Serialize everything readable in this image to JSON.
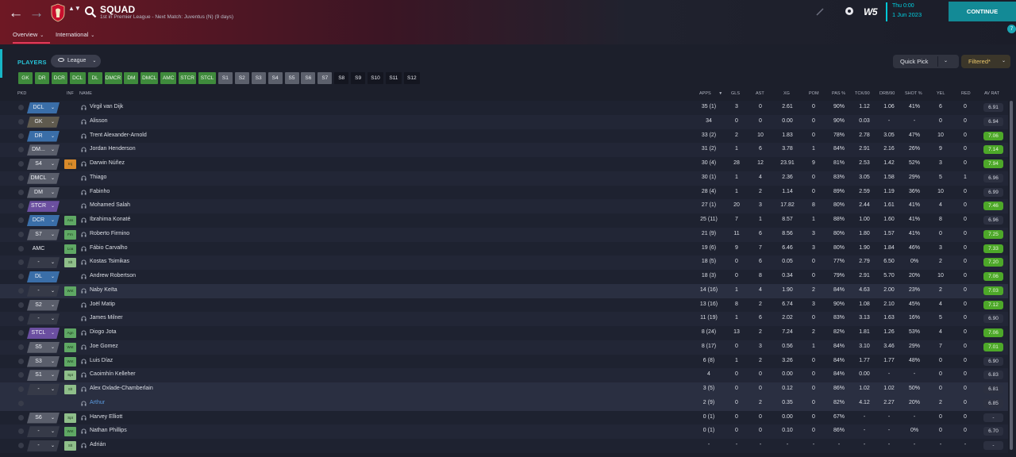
{
  "header": {
    "title": "SQUAD",
    "subtitle": "1st in Premier League - Next Match: Juventus (N) (9 days)",
    "back_glyph": "←",
    "forward_glyph": "→",
    "club_updown": "▲▼",
    "brand": "W5",
    "time": "Thu 0:00",
    "date": "1 Jun 2023",
    "continue": "CONTINUE",
    "notification_count": "7",
    "accent": "#17b6c6",
    "crest_color": "#c8102e"
  },
  "tabs": [
    {
      "label": "Overview",
      "chevron": "⌄"
    },
    {
      "label": "International",
      "chevron": "⌄"
    }
  ],
  "toolbar": {
    "players_label": "PLAYERS",
    "league_label": "League",
    "quick_pick": "Quick Pick",
    "filtered": "Filtered*",
    "chevron": "⌄"
  },
  "position_filters": [
    {
      "label": "GK",
      "style": "green"
    },
    {
      "label": "DR",
      "style": "green"
    },
    {
      "label": "DCR",
      "style": "green"
    },
    {
      "label": "DCL",
      "style": "green"
    },
    {
      "label": "DL",
      "style": "green"
    },
    {
      "label": "DMCR",
      "style": "green"
    },
    {
      "label": "DM",
      "style": "green"
    },
    {
      "label": "DMCL",
      "style": "green"
    },
    {
      "label": "AMC",
      "style": "green"
    },
    {
      "label": "STCR",
      "style": "green"
    },
    {
      "label": "STCL",
      "style": "green"
    },
    {
      "label": "S1",
      "style": "grey"
    },
    {
      "label": "S2",
      "style": "grey"
    },
    {
      "label": "S3",
      "style": "grey"
    },
    {
      "label": "S4",
      "style": "grey"
    },
    {
      "label": "S5",
      "style": "grey"
    },
    {
      "label": "S6",
      "style": "grey"
    },
    {
      "label": "S7",
      "style": "grey"
    },
    {
      "label": "S8",
      "style": "dark"
    },
    {
      "label": "S9",
      "style": "dark"
    },
    {
      "label": "S10",
      "style": "dark"
    },
    {
      "label": "S11",
      "style": "dark"
    },
    {
      "label": "S12",
      "style": "dark"
    }
  ],
  "columns": {
    "pkd": "PKD",
    "inf": "INF",
    "name": "NAME",
    "apps": "APPS",
    "sort": "▼",
    "gls": "GLS",
    "ast": "AST",
    "xg": "XG",
    "pom": "POM",
    "pas": "PAS %",
    "tck": "TCK/90",
    "drb": "DRB/90",
    "shot": "SHOT %",
    "yel": "YEL",
    "red": "RED",
    "avrat": "AV RAT"
  },
  "players": [
    {
      "pos": "DCL",
      "pos_color": "#3a6ea8",
      "inf": "",
      "inf_color": "",
      "name": "Virgil van Dijk",
      "apps": "35 (1)",
      "gls": "3",
      "ast": "0",
      "xg": "2.61",
      "pom": "0",
      "pas": "90%",
      "tck": "1.12",
      "drb": "1.06",
      "shot": "41%",
      "yel": "6",
      "red": "0",
      "rat": "6.91",
      "rat_good": false,
      "hl": false
    },
    {
      "pos": "GK",
      "pos_color": "#5f5a4e",
      "inf": "",
      "inf_color": "",
      "name": "Alisson",
      "apps": "34",
      "gls": "0",
      "ast": "0",
      "xg": "0.00",
      "pom": "0",
      "pas": "90%",
      "tck": "0.03",
      "drb": "-",
      "shot": "-",
      "yel": "0",
      "red": "0",
      "rat": "6.94",
      "rat_good": false,
      "hl": false
    },
    {
      "pos": "DR",
      "pos_color": "#3a6ea8",
      "inf": "",
      "inf_color": "",
      "name": "Trent Alexander-Arnold",
      "apps": "33 (2)",
      "gls": "2",
      "ast": "10",
      "xg": "1.83",
      "pom": "0",
      "pas": "78%",
      "tck": "2.78",
      "drb": "3.05",
      "shot": "47%",
      "yel": "10",
      "red": "0",
      "rat": "7.06",
      "rat_good": true,
      "hl": false
    },
    {
      "pos": "DM...",
      "pos_color": "#5a5e6b",
      "inf": "",
      "inf_color": "",
      "name": "Jordan Henderson",
      "apps": "31 (2)",
      "gls": "1",
      "ast": "6",
      "xg": "3.78",
      "pom": "1",
      "pas": "84%",
      "tck": "2.91",
      "drb": "2.16",
      "shot": "26%",
      "yel": "9",
      "red": "0",
      "rat": "7.14",
      "rat_good": true,
      "hl": false
    },
    {
      "pos": "S4",
      "pos_color": "#5a5e6b",
      "inf": "Inj",
      "inf_color": "#d98a2a",
      "name": "Darwin Núñez",
      "apps": "30 (4)",
      "gls": "28",
      "ast": "12",
      "xg": "23.91",
      "pom": "9",
      "pas": "81%",
      "tck": "2.53",
      "drb": "1.42",
      "shot": "52%",
      "yel": "3",
      "red": "0",
      "rat": "7.94",
      "rat_good": true,
      "hl": false
    },
    {
      "pos": "DMCL",
      "pos_color": "#5a5e6b",
      "inf": "",
      "inf_color": "",
      "name": "Thiago",
      "apps": "30 (1)",
      "gls": "1",
      "ast": "4",
      "xg": "2.36",
      "pom": "0",
      "pas": "83%",
      "tck": "3.05",
      "drb": "1.58",
      "shot": "29%",
      "yel": "5",
      "red": "1",
      "rat": "6.96",
      "rat_good": false,
      "hl": false
    },
    {
      "pos": "DM",
      "pos_color": "#5a5e6b",
      "inf": "",
      "inf_color": "",
      "name": "Fabinho",
      "apps": "28 (4)",
      "gls": "1",
      "ast": "2",
      "xg": "1.14",
      "pom": "0",
      "pas": "89%",
      "tck": "2.59",
      "drb": "1.19",
      "shot": "36%",
      "yel": "10",
      "red": "0",
      "rat": "6.99",
      "rat_good": false,
      "hl": false
    },
    {
      "pos": "STCR",
      "pos_color": "#6b4fa0",
      "inf": "",
      "inf_color": "",
      "name": "Mohamed Salah",
      "apps": "27 (1)",
      "gls": "20",
      "ast": "3",
      "xg": "17.82",
      "pom": "8",
      "pas": "80%",
      "tck": "2.44",
      "drb": "1.61",
      "shot": "41%",
      "yel": "4",
      "red": "0",
      "rat": "7.46",
      "rat_good": true,
      "hl": false
    },
    {
      "pos": "DCR",
      "pos_color": "#3a6ea8",
      "inf": "Ass",
      "inf_color": "#5fa864",
      "name": "Ibrahima Konaté",
      "apps": "25 (11)",
      "gls": "7",
      "ast": "1",
      "xg": "8.57",
      "pom": "1",
      "pas": "88%",
      "tck": "1.00",
      "drb": "1.60",
      "shot": "41%",
      "yel": "8",
      "red": "0",
      "rat": "6.96",
      "rat_good": false,
      "hl": false
    },
    {
      "pos": "S7",
      "pos_color": "#5a5e6b",
      "inf": "Frn",
      "inf_color": "#5fa864",
      "name": "Roberto Firmino",
      "apps": "21 (9)",
      "gls": "11",
      "ast": "6",
      "xg": "8.56",
      "pom": "3",
      "pas": "80%",
      "tck": "1.80",
      "drb": "1.57",
      "shot": "41%",
      "yel": "0",
      "red": "0",
      "rat": "7.25",
      "rat_good": true,
      "hl": false
    },
    {
      "pos": "AMC",
      "pos_color": "",
      "inf": "Loa",
      "inf_color": "#5fa864",
      "name": "Fábio Carvalho",
      "apps": "19 (6)",
      "gls": "9",
      "ast": "7",
      "xg": "6.46",
      "pom": "3",
      "pas": "80%",
      "tck": "1.90",
      "drb": "1.84",
      "shot": "46%",
      "yel": "3",
      "red": "0",
      "rat": "7.33",
      "rat_good": true,
      "hl": false
    },
    {
      "pos": "-",
      "pos_color": "#363a48",
      "inf": "Slt",
      "inf_color": "#8fbf8a",
      "name": "Kostas Tsimikas",
      "apps": "18 (5)",
      "gls": "0",
      "ast": "6",
      "xg": "0.05",
      "pom": "0",
      "pas": "77%",
      "tck": "2.79",
      "drb": "6.50",
      "shot": "0%",
      "yel": "2",
      "red": "0",
      "rat": "7.20",
      "rat_good": true,
      "hl": false
    },
    {
      "pos": "DL",
      "pos_color": "#3a6ea8",
      "inf": "",
      "inf_color": "",
      "name": "Andrew Robertson",
      "apps": "18 (3)",
      "gls": "0",
      "ast": "8",
      "xg": "0.34",
      "pom": "0",
      "pas": "79%",
      "tck": "2.91",
      "drb": "5.70",
      "shot": "20%",
      "yel": "10",
      "red": "0",
      "rat": "7.06",
      "rat_good": true,
      "hl": false
    },
    {
      "pos": "-",
      "pos_color": "#363a48",
      "inf": "Wnt",
      "inf_color": "#5fa864",
      "name": "Naby Keïta",
      "apps": "14 (16)",
      "gls": "1",
      "ast": "4",
      "xg": "1.90",
      "pom": "2",
      "pas": "84%",
      "tck": "4.63",
      "drb": "2.00",
      "shot": "23%",
      "yel": "2",
      "red": "0",
      "rat": "7.03",
      "rat_good": true,
      "hl": true
    },
    {
      "pos": "S2",
      "pos_color": "#5a5e6b",
      "inf": "",
      "inf_color": "",
      "name": "Joël Matip",
      "apps": "13 (16)",
      "gls": "8",
      "ast": "2",
      "xg": "6.74",
      "pom": "3",
      "pas": "90%",
      "tck": "1.08",
      "drb": "2.10",
      "shot": "45%",
      "yel": "4",
      "red": "0",
      "rat": "7.12",
      "rat_good": true,
      "hl": false
    },
    {
      "pos": "-",
      "pos_color": "#363a48",
      "inf": "",
      "inf_color": "",
      "name": "James Milner",
      "apps": "11 (19)",
      "gls": "1",
      "ast": "6",
      "xg": "2.02",
      "pom": "0",
      "pas": "83%",
      "tck": "3.13",
      "drb": "1.63",
      "shot": "16%",
      "yel": "5",
      "red": "0",
      "rat": "6.90",
      "rat_good": false,
      "hl": false
    },
    {
      "pos": "STCL",
      "pos_color": "#6b4fa0",
      "inf": "Agn",
      "inf_color": "#5fa864",
      "name": "Diogo Jota",
      "apps": "8 (24)",
      "gls": "13",
      "ast": "2",
      "xg": "7.24",
      "pom": "2",
      "pas": "82%",
      "tck": "1.81",
      "drb": "1.26",
      "shot": "53%",
      "yel": "4",
      "red": "0",
      "rat": "7.06",
      "rat_good": true,
      "hl": false
    },
    {
      "pos": "S5",
      "pos_color": "#5a5e6b",
      "inf": "Wnt",
      "inf_color": "#5fa864",
      "name": "Joe Gomez",
      "apps": "8 (17)",
      "gls": "0",
      "ast": "3",
      "xg": "0.56",
      "pom": "1",
      "pas": "84%",
      "tck": "3.10",
      "drb": "3.46",
      "shot": "29%",
      "yel": "7",
      "red": "0",
      "rat": "7.01",
      "rat_good": true,
      "hl": false
    },
    {
      "pos": "S3",
      "pos_color": "#5a5e6b",
      "inf": "Wnt",
      "inf_color": "#5fa864",
      "name": "Luis Díaz",
      "apps": "6 (8)",
      "gls": "1",
      "ast": "2",
      "xg": "3.26",
      "pom": "0",
      "pas": "84%",
      "tck": "1.77",
      "drb": "1.77",
      "shot": "48%",
      "yel": "0",
      "red": "0",
      "rat": "6.90",
      "rat_good": false,
      "hl": false
    },
    {
      "pos": "S1",
      "pos_color": "#5a5e6b",
      "inf": "Spt",
      "inf_color": "#8fbf8a",
      "name": "Caoimhín Kelleher",
      "apps": "4",
      "gls": "0",
      "ast": "0",
      "xg": "0.00",
      "pom": "0",
      "pas": "84%",
      "tck": "0.00",
      "drb": "-",
      "shot": "-",
      "yel": "0",
      "red": "0",
      "rat": "6.83",
      "rat_good": false,
      "hl": false
    },
    {
      "pos": "-",
      "pos_color": "#363a48",
      "inf": "Slt",
      "inf_color": "#8fbf8a",
      "name": "Alex Oxlade-Chamberlain",
      "apps": "3 (5)",
      "gls": "0",
      "ast": "0",
      "xg": "0.12",
      "pom": "0",
      "pas": "86%",
      "tck": "1.02",
      "drb": "1.02",
      "shot": "50%",
      "yel": "0",
      "red": "0",
      "rat": "6.81",
      "rat_good": false,
      "hl": true
    },
    {
      "pos": "",
      "pos_color": "",
      "inf": "",
      "inf_color": "",
      "name": "Arthur",
      "name_link": true,
      "apps": "2 (9)",
      "gls": "0",
      "ast": "2",
      "xg": "0.35",
      "pom": "0",
      "pas": "82%",
      "tck": "4.12",
      "drb": "2.27",
      "shot": "20%",
      "yel": "2",
      "red": "0",
      "rat": "6.85",
      "rat_good": false,
      "hl": true
    },
    {
      "pos": "S6",
      "pos_color": "#5a5e6b",
      "inf": "Spt",
      "inf_color": "#8fbf8a",
      "name": "Harvey Elliott",
      "apps": "0 (1)",
      "gls": "0",
      "ast": "0",
      "xg": "0.00",
      "pom": "0",
      "pas": "67%",
      "tck": "-",
      "drb": "-",
      "shot": "-",
      "yel": "0",
      "red": "0",
      "rat": "-",
      "rat_good": false,
      "hl": false
    },
    {
      "pos": "-",
      "pos_color": "#363a48",
      "inf": "Wnt",
      "inf_color": "#5fa864",
      "name": "Nathan Phillips",
      "apps": "0 (1)",
      "gls": "0",
      "ast": "0",
      "xg": "0.10",
      "pom": "0",
      "pas": "86%",
      "tck": "-",
      "drb": "-",
      "shot": "0%",
      "yel": "0",
      "red": "0",
      "rat": "6.70",
      "rat_good": false,
      "hl": false
    },
    {
      "pos": "-",
      "pos_color": "#363a48",
      "inf": "Slt",
      "inf_color": "#8fbf8a",
      "name": "Adrián",
      "apps": "-",
      "gls": "-",
      "ast": "-",
      "xg": "-",
      "pom": "-",
      "pas": "-",
      "tck": "-",
      "drb": "-",
      "shot": "-",
      "yel": "-",
      "red": "-",
      "rat": "-",
      "rat_good": false,
      "hl": false
    }
  ]
}
